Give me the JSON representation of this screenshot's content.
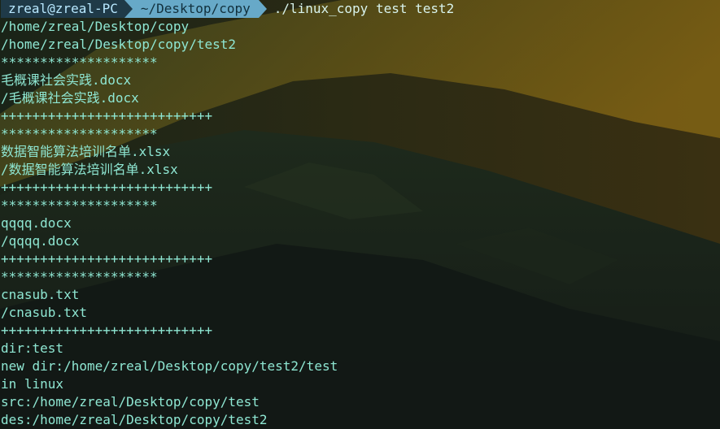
{
  "prompt": {
    "user_host": "zreal@zreal-PC",
    "path": "~/Desktop/copy",
    "command": "./linux_copy test test2"
  },
  "output_lines": [
    "/home/zreal/Desktop/copy",
    "/home/zreal/Desktop/copy/test2",
    "********************",
    "毛概课社会实践.docx",
    "/毛概课社会实践.docx",
    "+++++++++++++++++++++++++++",
    "********************",
    "数据智能算法培训名单.xlsx",
    "/数据智能算法培训名单.xlsx",
    "+++++++++++++++++++++++++++",
    "********************",
    "qqqq.docx",
    "/qqqq.docx",
    "+++++++++++++++++++++++++++",
    "********************",
    "cnasub.txt",
    "/cnasub.txt",
    "+++++++++++++++++++++++++++",
    "dir:test",
    "new dir:/home/zreal/Desktop/copy/test2/test",
    "in linux",
    "src:/home/zreal/Desktop/copy/test",
    "des:/home/zreal/Desktop/copy/test2"
  ],
  "colors": {
    "output_text": "#8ee6d2",
    "prompt_user_bg": "#1f3a48",
    "prompt_path_bg": "#67a9c8",
    "command_text": "#d8f3ec"
  }
}
